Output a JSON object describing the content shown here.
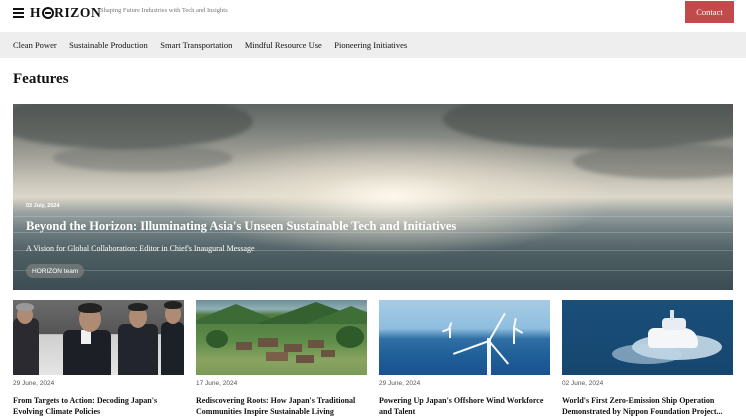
{
  "header": {
    "logo": "HORIZON",
    "tagline": "Shaping Future Industries with Tech and Insights",
    "contact_label": "Contact"
  },
  "nav": {
    "items": [
      {
        "label": "Clean Power"
      },
      {
        "label": "Sustainable Production"
      },
      {
        "label": "Smart Transportation"
      },
      {
        "label": "Mindful Resource Use"
      },
      {
        "label": "Pioneering Initiatives"
      }
    ]
  },
  "features": {
    "title": "Features",
    "hero": {
      "date": "03 July, 2024",
      "title": "Beyond the Horizon: Illuminating Asia's Unseen Sustainable Tech and Initiatives",
      "subtitle": "A Vision for Global Collaboration: Editor in Chief's Inaugural Message",
      "author": "HORIZON team"
    },
    "cards": [
      {
        "date": "29 June, 2024",
        "title": "From Targets to Action: Decoding Japan's Evolving Climate Policies"
      },
      {
        "date": "17 June, 2024",
        "title": "Rediscovering Roots: How Japan's Traditional Communities Inspire Sustainable Living"
      },
      {
        "date": "29 June, 2024",
        "title": "Powering Up Japan's Offshore Wind Workforce and Talent"
      },
      {
        "date": "02 June, 2024",
        "title": "World's First Zero-Emission Ship Operation Demonstrated by Nippon Foundation Project..."
      }
    ]
  },
  "colors": {
    "accent": "#c24a4a",
    "nav_bg": "#eeeeee"
  }
}
